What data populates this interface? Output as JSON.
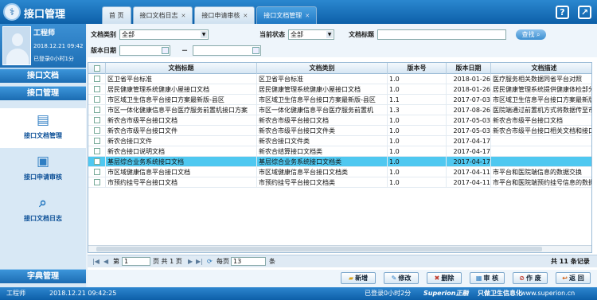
{
  "app": {
    "title": "接口管理"
  },
  "tabs": [
    {
      "label": "首  页",
      "closable": false,
      "active": false
    },
    {
      "label": "接口文档日志",
      "closable": true,
      "active": false
    },
    {
      "label": "接口申请审核",
      "closable": true,
      "active": false
    },
    {
      "label": "接口文档管理",
      "closable": true,
      "active": true
    }
  ],
  "top_icons": {
    "help": "help-icon",
    "exit": "exit-icon"
  },
  "user": {
    "name": "工程师",
    "time": "2018.12.21 09:42",
    "online": "已登录0小时1分"
  },
  "nav": {
    "group1": "接口文档",
    "group2": "接口管理",
    "items": [
      {
        "label": "接口文档管理",
        "icon": "document-settings-icon",
        "active": true
      },
      {
        "label": "接口申请审核",
        "icon": "document-approve-icon",
        "active": false
      },
      {
        "label": "接口文档日志",
        "icon": "document-search-icon",
        "active": false
      }
    ],
    "group3": "字典管理"
  },
  "filters": {
    "doc_type_label": "文档类别",
    "doc_type_value": "全部",
    "status_label": "当前状态",
    "status_value": "全部",
    "title_label": "文档标题",
    "title_value": "",
    "date_label": "版本日期",
    "date_from": "",
    "date_sep": "－",
    "date_to": "",
    "search_label": "查找"
  },
  "table": {
    "columns": [
      "",
      "文档标题",
      "文档类别",
      "版本号",
      "版本日期",
      "文档描述"
    ],
    "rows": [
      [
        "区卫省平台标准",
        "区卫省平台标准",
        "1.0",
        "2018-01-26",
        "医疗服务相关数据同省平台对照"
      ],
      [
        "居民健康管理系统健康小屋接口文档",
        "居民健康管理系统健康小屋接口文档",
        "1.0",
        "2018-01-26",
        "居民健康管理系统提供健康体检部分"
      ],
      [
        "市区域卫生信息平台接口方案最新版-县区",
        "市区域卫生信息平台接口方案最新版-县区",
        "1.1",
        "2017-07-03",
        "市区域卫生信息平台接口方案最新版"
      ],
      [
        "市区一体化健康信息平台医疗服务前置机接口方案",
        "市区一体化健康信息平台医疗服务前置机",
        "1.3",
        "2017-08-26",
        "医院端通过前置机方式将数据传至市"
      ],
      [
        "新农合市级平台接口文档",
        "新农合市级平台接口文档",
        "1.0",
        "2017-05-03",
        "新农合市级平台接口文档"
      ],
      [
        "新农合市级平台接口文件",
        "新农合市级平台接口文件类",
        "1.0",
        "2017-05-03",
        "新农合市级平台接口相关文档和接口"
      ],
      [
        "新农合接口文件",
        "新农合接口文件类",
        "1.0",
        "2017-04-17",
        ""
      ],
      [
        "新农合接口说明文档",
        "新农合结算接口文档类",
        "1.0",
        "2017-04-17",
        ""
      ],
      [
        "基层综合业务系统接口文档",
        "基层综合业务系统接口文档类",
        "1.0",
        "2017-04-17",
        ""
      ],
      [
        "市区域健康信息平台接口文档",
        "市区域健康信息平台接口文档类",
        "1.0",
        "2017-04-11",
        "市平台和医院端信息的数据交换"
      ],
      [
        "市预约挂号平台接口文档",
        "市预约挂号平台接口文档类",
        "1.0",
        "2017-04-11",
        "市平台和医院端预约挂号信息的数据"
      ]
    ],
    "selected_row": 8
  },
  "pager": {
    "page_label": "第",
    "page_value": "1",
    "page_total": "页 共 1 页",
    "per_page_label": "每页",
    "per_page_value": "13",
    "per_page_unit": "条",
    "total": "共 11 条记录"
  },
  "actions": [
    {
      "label": "新增",
      "icon": "folder-icon"
    },
    {
      "label": "修改",
      "icon": "edit-icon"
    },
    {
      "label": "删除",
      "icon": "delete-icon"
    },
    {
      "label": "审 核",
      "icon": "approve-icon"
    },
    {
      "label": "作 废",
      "icon": "void-icon"
    },
    {
      "label": "返 回",
      "icon": "back-icon"
    }
  ],
  "footer": {
    "user": "工程师",
    "time": "2018.12.21 09:42:25",
    "online": "已登录0小时2分",
    "brand": "Superion正融",
    "slogan": "只做卫生信息化",
    "site": "www.superion.cn"
  },
  "colors": {
    "brand": "#1466b0",
    "selected_row": "#4fc8f0",
    "delete": "#c0392b"
  }
}
